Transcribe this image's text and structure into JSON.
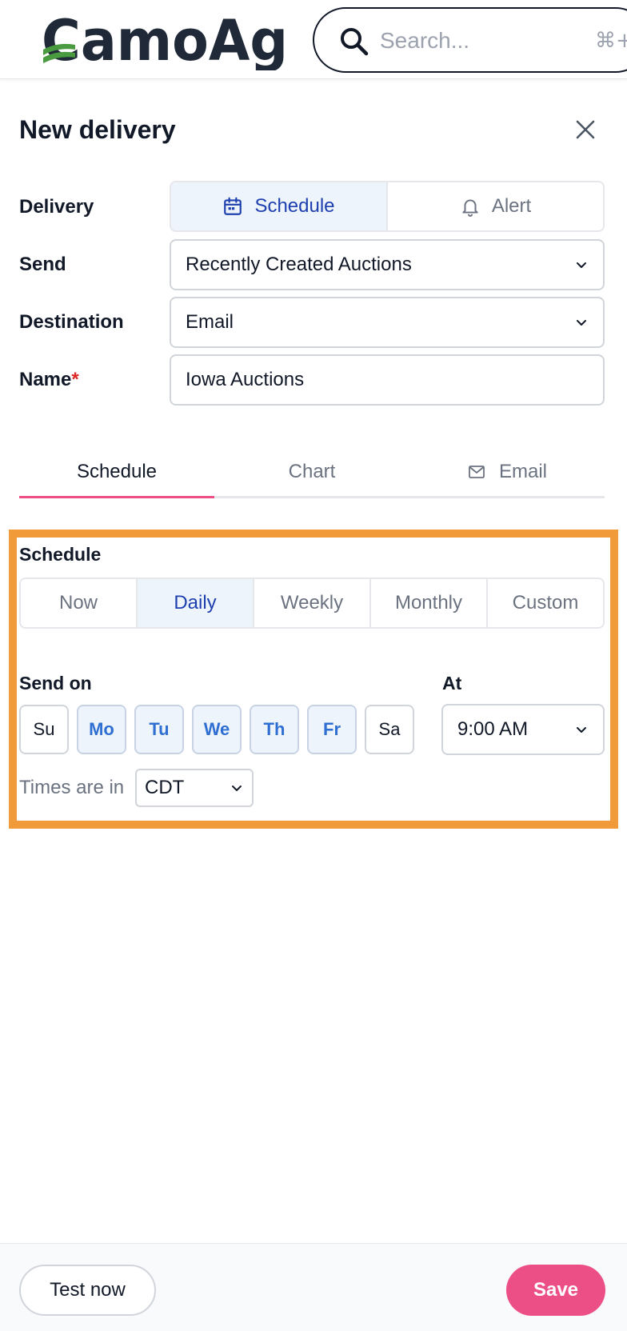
{
  "app": {
    "logo_text": "CamoAg"
  },
  "search": {
    "placeholder": "Search...",
    "shortcut": "⌘+"
  },
  "dialog": {
    "title": "New delivery"
  },
  "form": {
    "delivery_label": "Delivery",
    "delivery_options": [
      "Schedule",
      "Alert"
    ],
    "delivery_selected": "Schedule",
    "send_label": "Send",
    "send_value": "Recently Created Auctions",
    "destination_label": "Destination",
    "destination_value": "Email",
    "name_label": "Name",
    "name_required_mark": "*",
    "name_value": "Iowa Auctions"
  },
  "tabs": [
    {
      "label": "Schedule",
      "active": true
    },
    {
      "label": "Chart",
      "active": false
    },
    {
      "label": "Email",
      "active": false
    }
  ],
  "schedule": {
    "heading": "Schedule",
    "frequencies": [
      "Now",
      "Daily",
      "Weekly",
      "Monthly",
      "Custom"
    ],
    "frequency_selected": "Daily",
    "send_on_label": "Send on",
    "days": [
      {
        "label": "Su",
        "selected": false
      },
      {
        "label": "Mo",
        "selected": true
      },
      {
        "label": "Tu",
        "selected": true
      },
      {
        "label": "We",
        "selected": true
      },
      {
        "label": "Th",
        "selected": true
      },
      {
        "label": "Fr",
        "selected": true
      },
      {
        "label": "Sa",
        "selected": false
      }
    ],
    "at_label": "At",
    "time_value": "9:00 AM",
    "timezone_prefix": "Times are in",
    "timezone_value": "CDT"
  },
  "footer": {
    "test_label": "Test now",
    "save_label": "Save"
  },
  "colors": {
    "accent_pink": "#ec4f86",
    "selected_blue_text": "#1e40af",
    "selected_bg": "#eef4fc",
    "highlight_orange": "#f09a3a",
    "logo_dark": "#1f2937",
    "logo_green": "#4a9a3f"
  },
  "icons": {
    "search": "search-icon",
    "close": "close-icon",
    "calendar": "calendar-icon",
    "bell": "bell-icon",
    "mail": "mail-icon",
    "chevron": "chevron-down-icon"
  }
}
